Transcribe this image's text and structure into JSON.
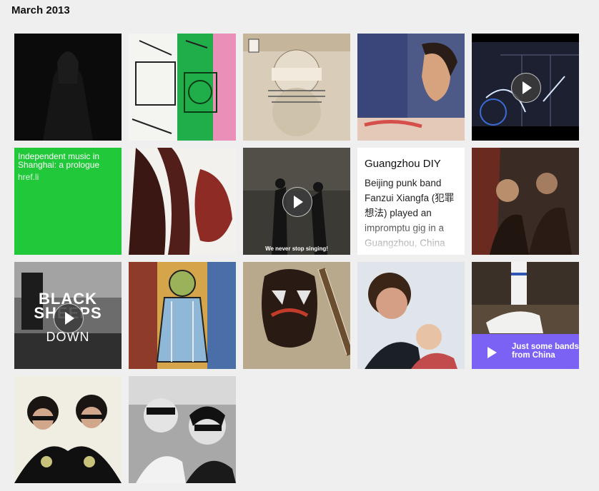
{
  "page": {
    "month_title": "March 2013"
  },
  "tiles": {
    "link": {
      "title": "Independent music in Shanghai: a prologue",
      "host": "href.li"
    },
    "text_post": {
      "title": "Guangzhou DIY",
      "body": "Beijing punk band Fanzui Xiangfa (犯罪想法) played an impromptu gig in a Guangzhou, China"
    },
    "audio_post": {
      "label": "Just some bands from China"
    },
    "video_caption": "We never stop singing!",
    "video_overlay": {
      "line1": "BLACK",
      "line2": "SHEEPS",
      "line3": "DOWN"
    }
  },
  "icons": {
    "play": "play-icon"
  },
  "colors": {
    "link_tile": "#21c93a",
    "audio_tile": "#7b62f4",
    "background": "#efefef"
  }
}
